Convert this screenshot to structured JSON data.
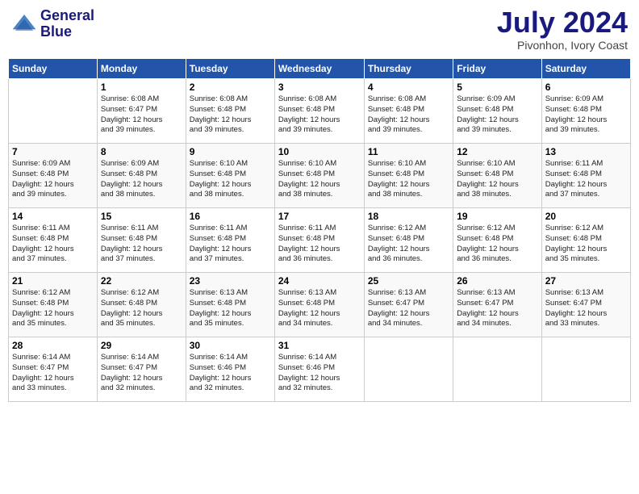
{
  "logo": {
    "line1": "General",
    "line2": "Blue"
  },
  "title": "July 2024",
  "location": "Pivonhon, Ivory Coast",
  "days_header": [
    "Sunday",
    "Monday",
    "Tuesday",
    "Wednesday",
    "Thursday",
    "Friday",
    "Saturday"
  ],
  "weeks": [
    [
      {
        "num": "",
        "info": ""
      },
      {
        "num": "1",
        "info": "Sunrise: 6:08 AM\nSunset: 6:47 PM\nDaylight: 12 hours\nand 39 minutes."
      },
      {
        "num": "2",
        "info": "Sunrise: 6:08 AM\nSunset: 6:48 PM\nDaylight: 12 hours\nand 39 minutes."
      },
      {
        "num": "3",
        "info": "Sunrise: 6:08 AM\nSunset: 6:48 PM\nDaylight: 12 hours\nand 39 minutes."
      },
      {
        "num": "4",
        "info": "Sunrise: 6:08 AM\nSunset: 6:48 PM\nDaylight: 12 hours\nand 39 minutes."
      },
      {
        "num": "5",
        "info": "Sunrise: 6:09 AM\nSunset: 6:48 PM\nDaylight: 12 hours\nand 39 minutes."
      },
      {
        "num": "6",
        "info": "Sunrise: 6:09 AM\nSunset: 6:48 PM\nDaylight: 12 hours\nand 39 minutes."
      }
    ],
    [
      {
        "num": "7",
        "info": "Sunrise: 6:09 AM\nSunset: 6:48 PM\nDaylight: 12 hours\nand 39 minutes."
      },
      {
        "num": "8",
        "info": "Sunrise: 6:09 AM\nSunset: 6:48 PM\nDaylight: 12 hours\nand 38 minutes."
      },
      {
        "num": "9",
        "info": "Sunrise: 6:10 AM\nSunset: 6:48 PM\nDaylight: 12 hours\nand 38 minutes."
      },
      {
        "num": "10",
        "info": "Sunrise: 6:10 AM\nSunset: 6:48 PM\nDaylight: 12 hours\nand 38 minutes."
      },
      {
        "num": "11",
        "info": "Sunrise: 6:10 AM\nSunset: 6:48 PM\nDaylight: 12 hours\nand 38 minutes."
      },
      {
        "num": "12",
        "info": "Sunrise: 6:10 AM\nSunset: 6:48 PM\nDaylight: 12 hours\nand 38 minutes."
      },
      {
        "num": "13",
        "info": "Sunrise: 6:11 AM\nSunset: 6:48 PM\nDaylight: 12 hours\nand 37 minutes."
      }
    ],
    [
      {
        "num": "14",
        "info": "Sunrise: 6:11 AM\nSunset: 6:48 PM\nDaylight: 12 hours\nand 37 minutes."
      },
      {
        "num": "15",
        "info": "Sunrise: 6:11 AM\nSunset: 6:48 PM\nDaylight: 12 hours\nand 37 minutes."
      },
      {
        "num": "16",
        "info": "Sunrise: 6:11 AM\nSunset: 6:48 PM\nDaylight: 12 hours\nand 37 minutes."
      },
      {
        "num": "17",
        "info": "Sunrise: 6:11 AM\nSunset: 6:48 PM\nDaylight: 12 hours\nand 36 minutes."
      },
      {
        "num": "18",
        "info": "Sunrise: 6:12 AM\nSunset: 6:48 PM\nDaylight: 12 hours\nand 36 minutes."
      },
      {
        "num": "19",
        "info": "Sunrise: 6:12 AM\nSunset: 6:48 PM\nDaylight: 12 hours\nand 36 minutes."
      },
      {
        "num": "20",
        "info": "Sunrise: 6:12 AM\nSunset: 6:48 PM\nDaylight: 12 hours\nand 35 minutes."
      }
    ],
    [
      {
        "num": "21",
        "info": "Sunrise: 6:12 AM\nSunset: 6:48 PM\nDaylight: 12 hours\nand 35 minutes."
      },
      {
        "num": "22",
        "info": "Sunrise: 6:12 AM\nSunset: 6:48 PM\nDaylight: 12 hours\nand 35 minutes."
      },
      {
        "num": "23",
        "info": "Sunrise: 6:13 AM\nSunset: 6:48 PM\nDaylight: 12 hours\nand 35 minutes."
      },
      {
        "num": "24",
        "info": "Sunrise: 6:13 AM\nSunset: 6:48 PM\nDaylight: 12 hours\nand 34 minutes."
      },
      {
        "num": "25",
        "info": "Sunrise: 6:13 AM\nSunset: 6:47 PM\nDaylight: 12 hours\nand 34 minutes."
      },
      {
        "num": "26",
        "info": "Sunrise: 6:13 AM\nSunset: 6:47 PM\nDaylight: 12 hours\nand 34 minutes."
      },
      {
        "num": "27",
        "info": "Sunrise: 6:13 AM\nSunset: 6:47 PM\nDaylight: 12 hours\nand 33 minutes."
      }
    ],
    [
      {
        "num": "28",
        "info": "Sunrise: 6:14 AM\nSunset: 6:47 PM\nDaylight: 12 hours\nand 33 minutes."
      },
      {
        "num": "29",
        "info": "Sunrise: 6:14 AM\nSunset: 6:47 PM\nDaylight: 12 hours\nand 32 minutes."
      },
      {
        "num": "30",
        "info": "Sunrise: 6:14 AM\nSunset: 6:46 PM\nDaylight: 12 hours\nand 32 minutes."
      },
      {
        "num": "31",
        "info": "Sunrise: 6:14 AM\nSunset: 6:46 PM\nDaylight: 12 hours\nand 32 minutes."
      },
      {
        "num": "",
        "info": ""
      },
      {
        "num": "",
        "info": ""
      },
      {
        "num": "",
        "info": ""
      }
    ]
  ]
}
